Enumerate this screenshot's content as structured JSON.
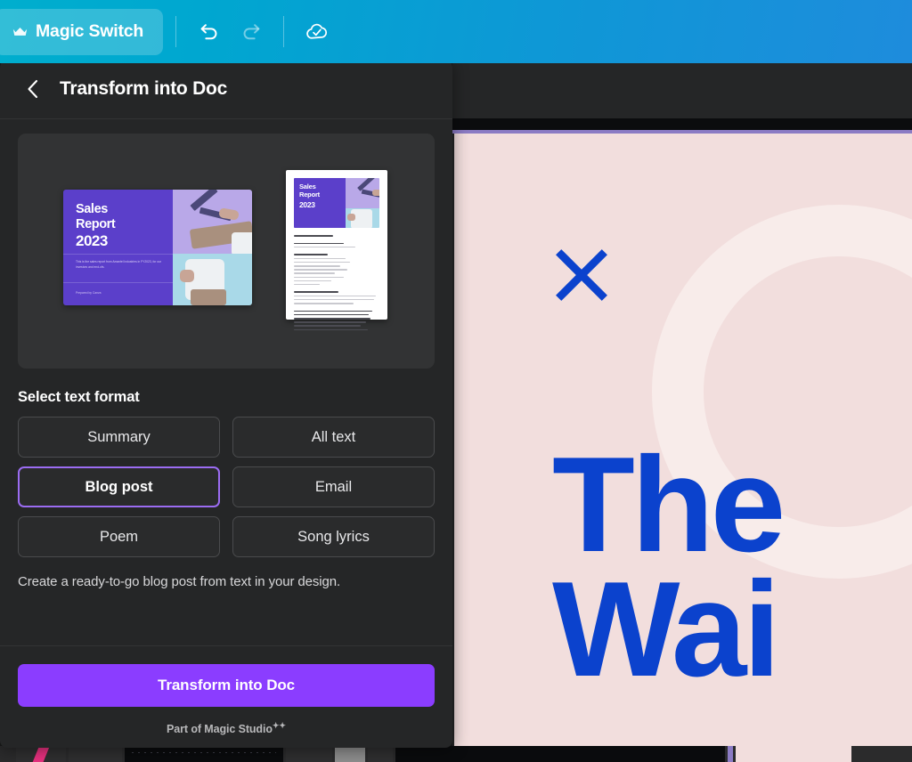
{
  "topbar": {
    "magic_switch_label": "Magic Switch",
    "crown_icon": "crown-icon",
    "undo_icon": "undo-icon",
    "redo_icon": "redo-icon",
    "saved_icon": "cloud-check-icon"
  },
  "panel": {
    "back_icon": "chevron-left-icon",
    "title": "Transform into Doc",
    "preview": {
      "slide": {
        "title_line1": "Sales",
        "title_line2": "Report",
        "year": "2023",
        "body": "This is the sales report from Amantel Industries in FY2023, for our investors and end-ofs.",
        "prepared_by": "Prepared by Canva"
      },
      "doc": {
        "title_line1": "Sales",
        "title_line2": "Report",
        "year": "2023"
      }
    },
    "section_label": "Select text format",
    "formats": [
      {
        "label": "Summary",
        "selected": false
      },
      {
        "label": "All text",
        "selected": false
      },
      {
        "label": "Blog post",
        "selected": true
      },
      {
        "label": "Email",
        "selected": false
      },
      {
        "label": "Poem",
        "selected": false
      },
      {
        "label": "Song lyrics",
        "selected": false
      }
    ],
    "description": "Create a ready-to-go blog post from text in your design.",
    "cta_label": "Transform into Doc",
    "magic_studio_label": "Part of Magic Studio"
  },
  "canvas": {
    "x_mark_icon": "x-mark-shape",
    "heading_line1": "The",
    "heading_line2": "Wai"
  },
  "colors": {
    "topbar_start": "#00AECE",
    "topbar_end": "#1E8CDC",
    "panel_bg": "#252627",
    "cta_purple": "#8B3DFF",
    "selected_border": "#9B6CF2",
    "canvas_bg": "#F2DEDD",
    "canvas_text": "#0B42CD",
    "slide_purple": "#5B3FCA",
    "accent_line": "#8B7BC4"
  }
}
